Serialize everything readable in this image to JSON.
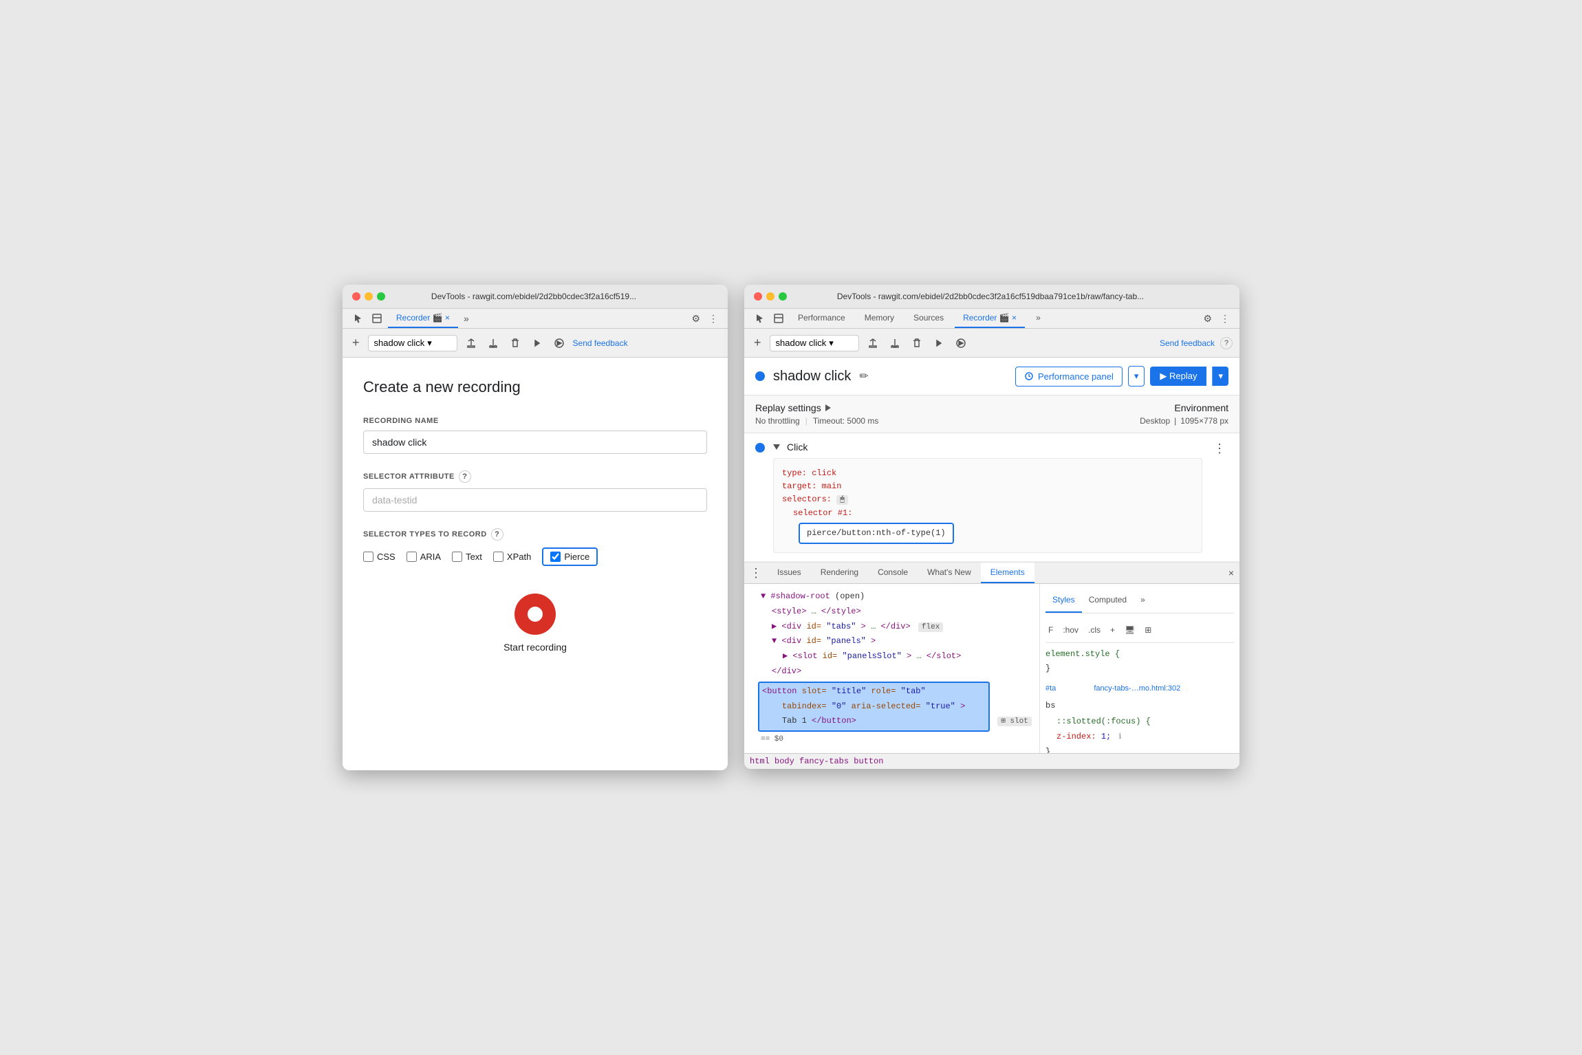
{
  "left_window": {
    "title": "DevTools - rawgit.com/ebidel/2d2bb0cdec3f2a16cf519...",
    "tab_label": "Recorder",
    "tab_icon": "🎬",
    "add_recording_tooltip": "Add recording",
    "recording_selector_value": "shadow click",
    "toolbar_icons": [
      "upload",
      "download",
      "delete",
      "replay-once",
      "replay"
    ],
    "send_feedback_label": "Send feedback",
    "form": {
      "title": "Create a new recording",
      "recording_name_label": "RECORDING NAME",
      "recording_name_value": "shadow click",
      "selector_attribute_label": "SELECTOR ATTRIBUTE",
      "selector_attribute_placeholder": "data-testid",
      "selector_attribute_help": "?",
      "selector_types_label": "SELECTOR TYPES TO RECORD",
      "selector_types_help": "?",
      "checkboxes": [
        {
          "id": "css",
          "label": "CSS",
          "checked": false
        },
        {
          "id": "aria",
          "label": "ARIA",
          "checked": false
        },
        {
          "id": "text",
          "label": "Text",
          "checked": false
        },
        {
          "id": "xpath",
          "label": "XPath",
          "checked": false
        },
        {
          "id": "pierce",
          "label": "Pierce",
          "checked": true
        }
      ],
      "start_recording_label": "Start recording"
    }
  },
  "right_window": {
    "title": "DevTools - rawgit.com/ebidel/2d2bb0cdec3f2a16cf519dbaa791ce1b/raw/fancy-tab...",
    "devtools_tabs": [
      "Performance",
      "Memory",
      "Sources",
      "Recorder",
      "»"
    ],
    "active_tab": "Recorder",
    "settings_icon": "⚙",
    "more_icon": "⋮",
    "add_icon": "+",
    "recording_selector_value": "shadow click",
    "send_feedback_label": "Send feedback",
    "help_icon": "?",
    "recording_header": {
      "dot_color": "#1a73e8",
      "name": "shadow click",
      "edit_icon": "✏"
    },
    "performance_panel_btn": "Performance panel",
    "performance_panel_dropdown": "▾",
    "replay_btn": "▶ Replay",
    "replay_dropdown": "▾",
    "replay_settings": {
      "title": "Replay settings",
      "triangle": "▶",
      "no_throttling": "No throttling",
      "timeout": "Timeout: 5000 ms",
      "environment_label": "Environment",
      "desktop": "Desktop",
      "resolution": "1095×778 px"
    },
    "steps": [
      {
        "type": "Click",
        "indicator_color": "#1a73e8",
        "code": {
          "type_key": "type:",
          "type_val": "click",
          "target_key": "target:",
          "target_val": "main",
          "selectors_key": "selectors:",
          "selectors_icon": "🖱",
          "selector_num_label": "selector #1:",
          "selector_value": "pierce/button:nth-of-type(1)"
        }
      }
    ],
    "devtools_panel": {
      "tabs": [
        "Issues",
        "Rendering",
        "Console",
        "What's New",
        "Elements"
      ],
      "active_tab": "Elements",
      "dom_content": {
        "line1": "▼ #shadow-root (open)",
        "line2": "<style>…</style>",
        "line3": "▶ <div id=\"tabs\">…</div>",
        "line3_badge": "flex",
        "line4": "▼ <div id=\"panels\">",
        "line5": "▶ <slot id=\"panelsSlot\">…</slot>",
        "line6": "</div>",
        "selected_line": "<button slot=\"title\" role=\"tab\"\n   tabindex=\"0\" aria-selected=\"true\">\n   Tab 1</button>",
        "selected_badge": "slot",
        "selected_equals": "== $0"
      },
      "breadcrumb": [
        "html",
        "body",
        "fancy-tabs",
        "button"
      ],
      "styles_panel": {
        "tabs": [
          "Styles",
          "Computed",
          "»"
        ],
        "active_tab": "Styles",
        "toolbar_items": [
          "F",
          ":hov",
          ".cls",
          "+",
          "🖥",
          "⊞"
        ],
        "rules": [
          {
            "selector": "element.style {",
            "closing": "}",
            "properties": []
          },
          {
            "source_file": "fancy-tabs-…mo.html:302",
            "selector": "#ta",
            "closing_bs": "bs",
            "pseudo": "::slotted(:focus) {",
            "properties": [
              {
                "name": "z-index:",
                "value": "1;"
              }
            ],
            "info_icon": "ℹ"
          }
        ],
        "closing_brace": "}"
      }
    }
  }
}
